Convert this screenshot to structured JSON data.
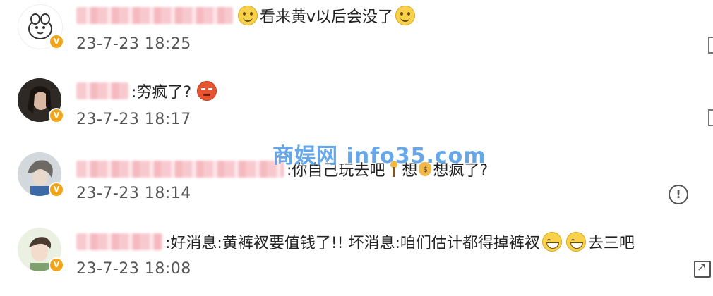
{
  "watermark": "商娱网 info35.com",
  "comments": [
    {
      "text_parts": [
        "看来黄v以后会没了"
      ],
      "time": "23-7-23 18:25"
    },
    {
      "text_parts": [
        ":穷疯了?"
      ],
      "time": "23-7-23 18:17"
    },
    {
      "text_parts": [
        ":你自己玩去吧",
        "想",
        "想疯了?"
      ],
      "time": "23-7-23 18:14"
    },
    {
      "text_parts": [
        ":好消息:黄裤衩要值钱了!!  坏消息:咱们估计都得掉裤衩",
        "去三吧"
      ],
      "time": "23-7-23 18:08"
    }
  ],
  "icons": {
    "verified": "verified-badge-icon",
    "report": "report-icon",
    "share": "share-icon"
  },
  "colors": {
    "watermark": "#5aa0e8",
    "badge": "#f2a51b"
  }
}
